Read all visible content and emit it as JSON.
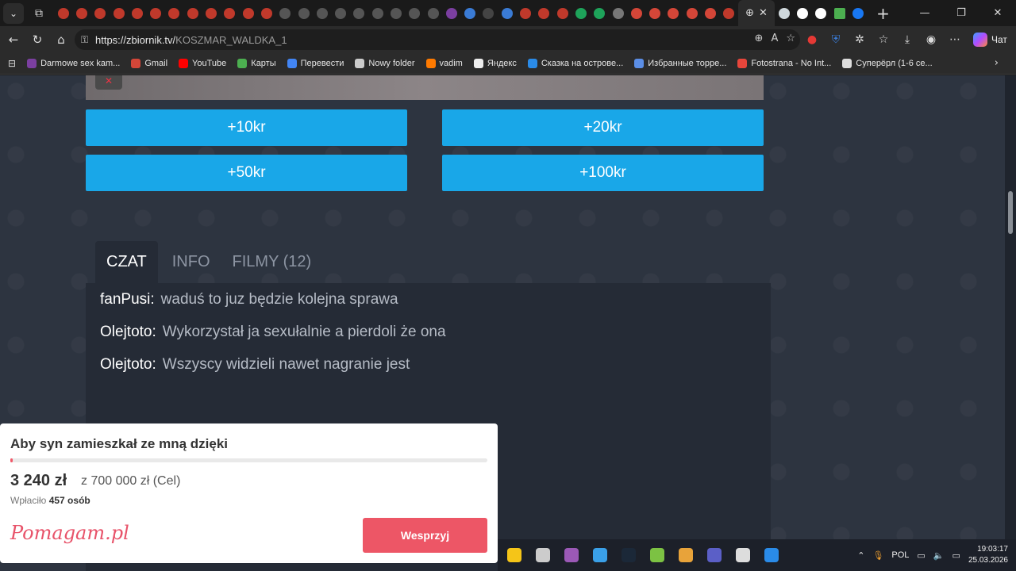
{
  "browser": {
    "url_host": "https://zbiornik.tv/",
    "url_path": "KOSZMAR_WALDKA_1",
    "chat_label": "Чат",
    "tab_colors": [
      "#c0392b",
      "#c0392b",
      "#c0392b",
      "#c0392b",
      "#c0392b",
      "#c0392b",
      "#c0392b",
      "#c0392b",
      "#c0392b",
      "#c0392b",
      "#c0392b",
      "#c0392b",
      "#555",
      "#555",
      "#555",
      "#555",
      "#555",
      "#555",
      "#555",
      "#555",
      "#555",
      "#7b3fa0",
      "#3a7bd5",
      "#444",
      "#3a7bd5",
      "#c0392b",
      "#c0392b",
      "#c0392b",
      "#1ea35a",
      "#1ea35a",
      "#777",
      "#d44638",
      "#d44638",
      "#d44638",
      "#d44638",
      "#d44638",
      "#c0392b"
    ]
  },
  "bookmarks": [
    {
      "label": "Darmowe sex kam...",
      "color": "#7b3fa0"
    },
    {
      "label": "Gmail",
      "color": "#d44638"
    },
    {
      "label": "YouTube",
      "color": "#ff0000"
    },
    {
      "label": "Карты",
      "color": "#4caf50"
    },
    {
      "label": "Перевести",
      "color": "#4285f4"
    },
    {
      "label": "Nowy folder",
      "color": "#cccccc"
    },
    {
      "label": "vadim",
      "color": "#ff7a00"
    },
    {
      "label": "Яндекс",
      "color": "#eeeeee"
    },
    {
      "label": "Сказка на острове...",
      "color": "#2a8be8"
    },
    {
      "label": "Избранные торре...",
      "color": "#5b8ee6"
    },
    {
      "label": "Fotostrana - No Int...",
      "color": "#e8463b"
    },
    {
      "label": "Суперёрл (1-6 се...",
      "color": "#dddddd"
    }
  ],
  "tips": [
    "+10kr",
    "+20kr",
    "+50kr",
    "+100kr"
  ],
  "page_tabs": {
    "chat": "CZAT",
    "info": "INFO",
    "films": "FILMY (12)"
  },
  "chat": [
    {
      "user": "fanPusi:",
      "text": "waduś to juz będzie kolejna sprawa"
    },
    {
      "user": "Olejtoto:",
      "text": "Wykorzystał ja sexułalnie a pierdoli że ona"
    },
    {
      "user": "Olejtoto:",
      "text": "Wszyscy widzieli nawet nagranie jest"
    }
  ],
  "widget": {
    "title": "Aby syn zamieszkał ze mną dzięki",
    "amount": "3 240 zł",
    "goal": "z 700 000 zł (Cel)",
    "donors_prefix": "Wpłaciło",
    "donors_count": "457 osób",
    "logo": "Pomagam.pl",
    "button": "Wesprzyj",
    "progress_fraction": 0.0046
  },
  "taskbar": {
    "apps": [
      "#f5c518",
      "#cccccc",
      "#9b59b6",
      "#3aa0e8",
      "#1b2838",
      "#7cc243",
      "#e8a33a",
      "#5b5fc7",
      "#dddddd",
      "#2a8be8"
    ],
    "lang": "POL",
    "time": "19:03:17",
    "date": "25.03.2026"
  }
}
